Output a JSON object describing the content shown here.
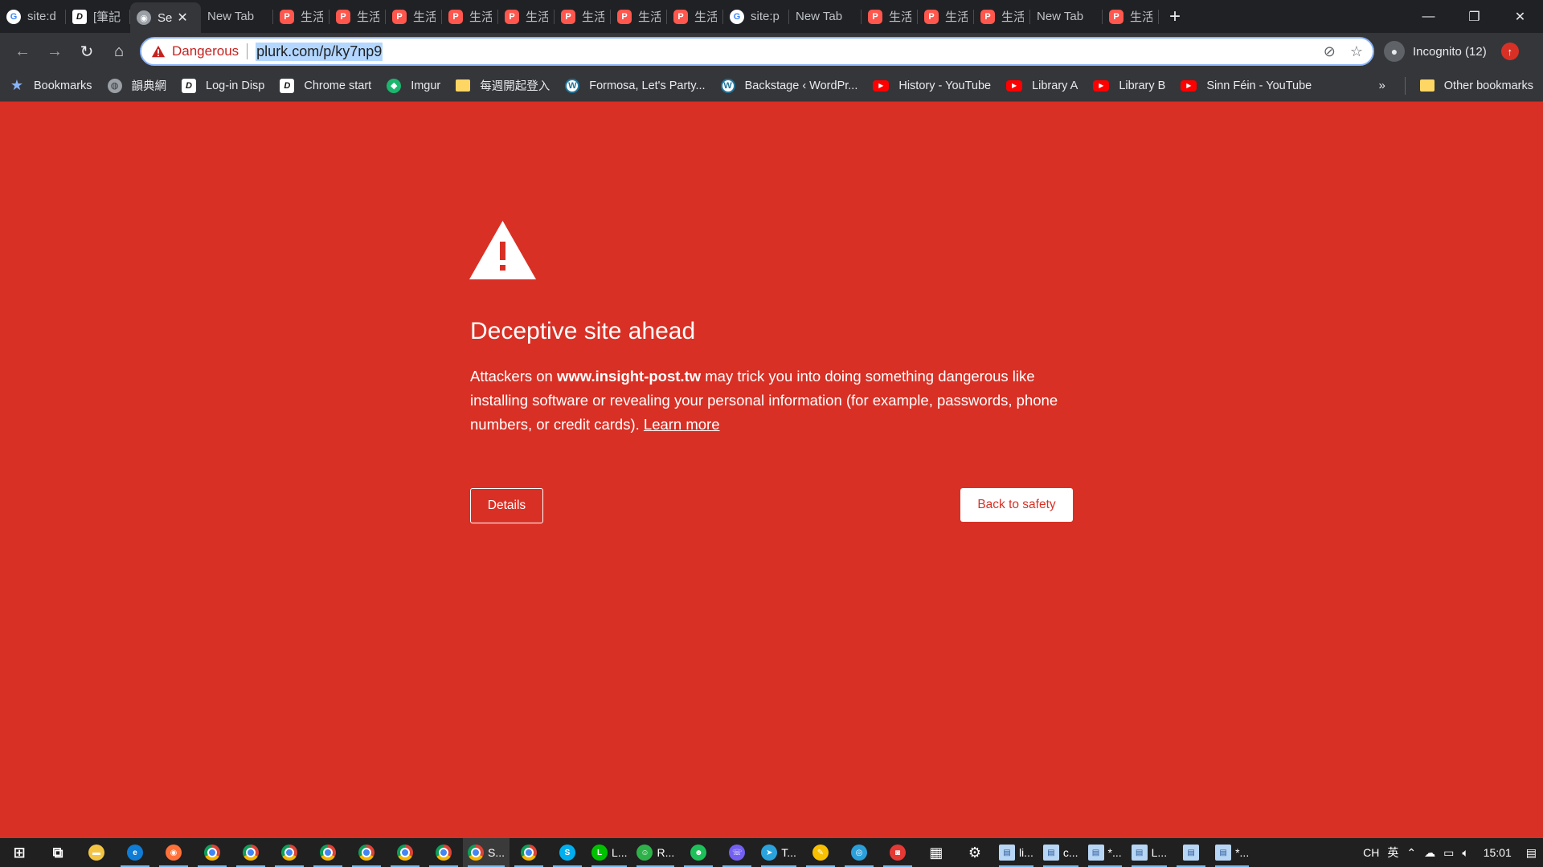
{
  "tabs": [
    {
      "icon": "google",
      "title": "site:d",
      "active": false
    },
    {
      "icon": "d",
      "title": "[筆記",
      "active": false
    },
    {
      "icon": "globe",
      "title": "Se",
      "active": true
    },
    {
      "icon": "none",
      "title": "New Tab",
      "active": false
    },
    {
      "icon": "plurk",
      "title": "生活",
      "active": false
    },
    {
      "icon": "plurk",
      "title": "生活",
      "active": false
    },
    {
      "icon": "plurk",
      "title": "生活",
      "active": false
    },
    {
      "icon": "plurk",
      "title": "生活",
      "active": false
    },
    {
      "icon": "plurk",
      "title": "生活",
      "active": false
    },
    {
      "icon": "plurk",
      "title": "生活",
      "active": false
    },
    {
      "icon": "plurk",
      "title": "生活",
      "active": false
    },
    {
      "icon": "plurk",
      "title": "生活",
      "active": false
    },
    {
      "icon": "google",
      "title": "site:p",
      "active": false
    },
    {
      "icon": "none",
      "title": "New Tab",
      "active": false
    },
    {
      "icon": "plurk",
      "title": "生活",
      "active": false
    },
    {
      "icon": "plurk",
      "title": "生活",
      "active": false
    },
    {
      "icon": "plurk",
      "title": "生活",
      "active": false
    },
    {
      "icon": "none",
      "title": "New Tab",
      "active": false
    },
    {
      "icon": "plurk",
      "title": "生活",
      "active": false
    }
  ],
  "omnibox": {
    "security_label": "Dangerous",
    "url": "plurk.com/p/ky7np9"
  },
  "profile": {
    "label": "Incognito (12)"
  },
  "bookmarks": [
    {
      "icon": "star",
      "label": "Bookmarks"
    },
    {
      "icon": "globe",
      "label": "韻典網"
    },
    {
      "icon": "d",
      "label": "Log-in Disp"
    },
    {
      "icon": "d",
      "label": "Chrome start"
    },
    {
      "icon": "img",
      "label": "Imgur"
    },
    {
      "icon": "folder",
      "label": "每週開起登入"
    },
    {
      "icon": "wp",
      "label": "Formosa, Let's Party..."
    },
    {
      "icon": "wp",
      "label": "Backstage ‹ WordPr..."
    },
    {
      "icon": "yt",
      "label": "History - YouTube"
    },
    {
      "icon": "yt",
      "label": "Library A"
    },
    {
      "icon": "yt",
      "label": "Library B"
    },
    {
      "icon": "yt",
      "label": "Sinn Féin - YouTube"
    }
  ],
  "bookmarks_more": "»",
  "other_bookmarks": "Other bookmarks",
  "interstitial": {
    "heading": "Deceptive site ahead",
    "body_prefix": "Attackers on ",
    "site": "www.insight-post.tw",
    "body_suffix": " may trick you into doing something dangerous like installing software or revealing your personal information (for example, passwords, phone numbers, or credit cards). ",
    "learn_more": "Learn more",
    "details_button": "Details",
    "back_button": "Back to safety",
    "background_color": "#d93025"
  },
  "taskbar": {
    "items": [
      {
        "icon": "start",
        "label": ""
      },
      {
        "icon": "task-view",
        "label": ""
      },
      {
        "icon": "file-explorer",
        "label": ""
      },
      {
        "icon": "edge",
        "label": ""
      },
      {
        "icon": "firefox",
        "label": ""
      },
      {
        "icon": "chrome",
        "label": ""
      },
      {
        "icon": "chrome",
        "label": ""
      },
      {
        "icon": "chrome",
        "label": ""
      },
      {
        "icon": "chrome",
        "label": ""
      },
      {
        "icon": "chrome",
        "label": ""
      },
      {
        "icon": "chrome",
        "label": ""
      },
      {
        "icon": "chrome",
        "label": ""
      },
      {
        "icon": "chrome",
        "label": "S..."
      },
      {
        "icon": "chrome",
        "label": ""
      },
      {
        "icon": "skype",
        "label": ""
      },
      {
        "icon": "line",
        "label": "L..."
      },
      {
        "icon": "contacts",
        "label": "R..."
      },
      {
        "icon": "people",
        "label": ""
      },
      {
        "icon": "viber",
        "label": ""
      },
      {
        "icon": "telegram",
        "label": "T..."
      },
      {
        "icon": "notes",
        "label": ""
      },
      {
        "icon": "instagram",
        "label": ""
      },
      {
        "icon": "camera",
        "label": ""
      },
      {
        "icon": "clapper",
        "label": ""
      },
      {
        "icon": "settings",
        "label": ""
      },
      {
        "icon": "notepad",
        "label": "li..."
      },
      {
        "icon": "notepad",
        "label": "c..."
      },
      {
        "icon": "notepad",
        "label": "*..."
      },
      {
        "icon": "notepad",
        "label": "L..."
      },
      {
        "icon": "notepad",
        "label": ""
      },
      {
        "icon": "notepad",
        "label": "*..."
      }
    ],
    "tray": {
      "lang": "CH",
      "ime": "英",
      "time": "15:01"
    }
  }
}
